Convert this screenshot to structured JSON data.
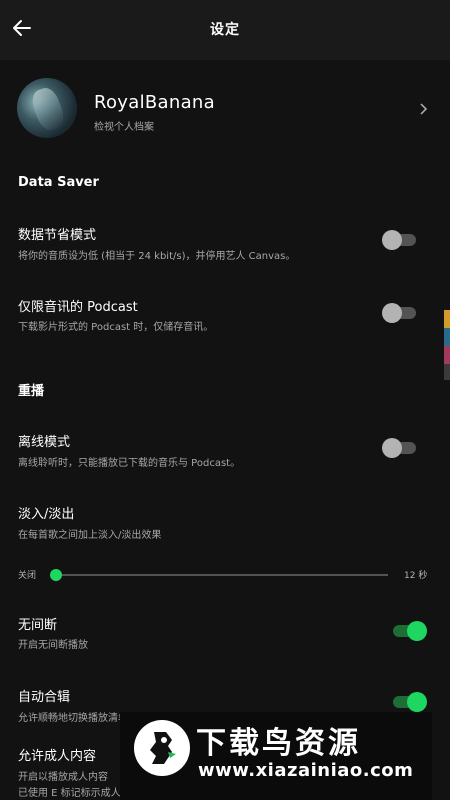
{
  "header": {
    "title": "设定",
    "back_icon": "back-arrow-icon"
  },
  "profile": {
    "name": "RoyalBanana",
    "subtitle": "检视个人档案",
    "chevron_icon": "chevron-right-icon"
  },
  "data_saver": {
    "heading": "Data Saver",
    "items": [
      {
        "title": "数据节省模式",
        "subtitle": "将你的音质设为低 (相当于 24 kbit/s)，并停用艺人 Canvas。",
        "enabled": false
      },
      {
        "title": "仅限音讯的 Podcast",
        "subtitle": "下载影片形式的 Podcast 时，仅储存音讯。",
        "enabled": false
      }
    ]
  },
  "playback": {
    "heading": "重播",
    "offline": {
      "title": "离线模式",
      "subtitle": "离线聆听时，只能播放已下载的音乐与 Podcast。",
      "enabled": false
    },
    "crossfade": {
      "title": "淡入/淡出",
      "subtitle": "在每首歌之间加上淡入/淡出效果",
      "min_label": "关闭",
      "max_label": "12 秒",
      "value": 0
    },
    "gapless": {
      "title": "无间断",
      "subtitle": "开启无间断播放",
      "enabled": true
    },
    "automix": {
      "title": "自动合辑",
      "subtitle": "允许顺畅地切换播放清单中的歌曲",
      "enabled": true
    },
    "explicit": {
      "title": "允许成人内容",
      "subtitle": "开启以播放成人内容",
      "subtitle2": "已使用 E 标记标示成人内容"
    }
  },
  "watermark": {
    "title": "下载鸟资源",
    "url": "www.xiazainiao.com"
  },
  "colors": {
    "background": "#121212",
    "accent": "#1ed760",
    "muted_text": "#a7a7a7",
    "toggle_off": "#b3b3b3"
  }
}
